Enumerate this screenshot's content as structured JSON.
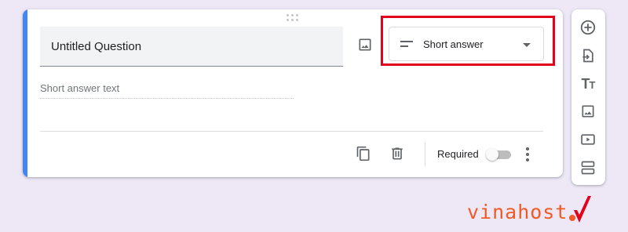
{
  "question": {
    "title": "Untitled Question",
    "answer_placeholder": "Short answer text"
  },
  "type_select": {
    "selected": "Short answer",
    "icon": "short-text-icon",
    "highlight_color": "#e2001a"
  },
  "footer": {
    "required_label": "Required",
    "required_on": false,
    "actions": [
      "duplicate-icon",
      "delete-icon",
      "more-vert-icon"
    ]
  },
  "toolbar": {
    "items": [
      "add-question-icon",
      "import-questions-icon",
      "add-title-icon",
      "add-image-icon",
      "add-video-icon",
      "add-section-icon"
    ],
    "title_glyph": "TT"
  },
  "brand": {
    "logo_text": "vinahost"
  },
  "colors": {
    "accent": "#4285f4",
    "background": "#ede7f6",
    "logo": "#f15a24"
  }
}
